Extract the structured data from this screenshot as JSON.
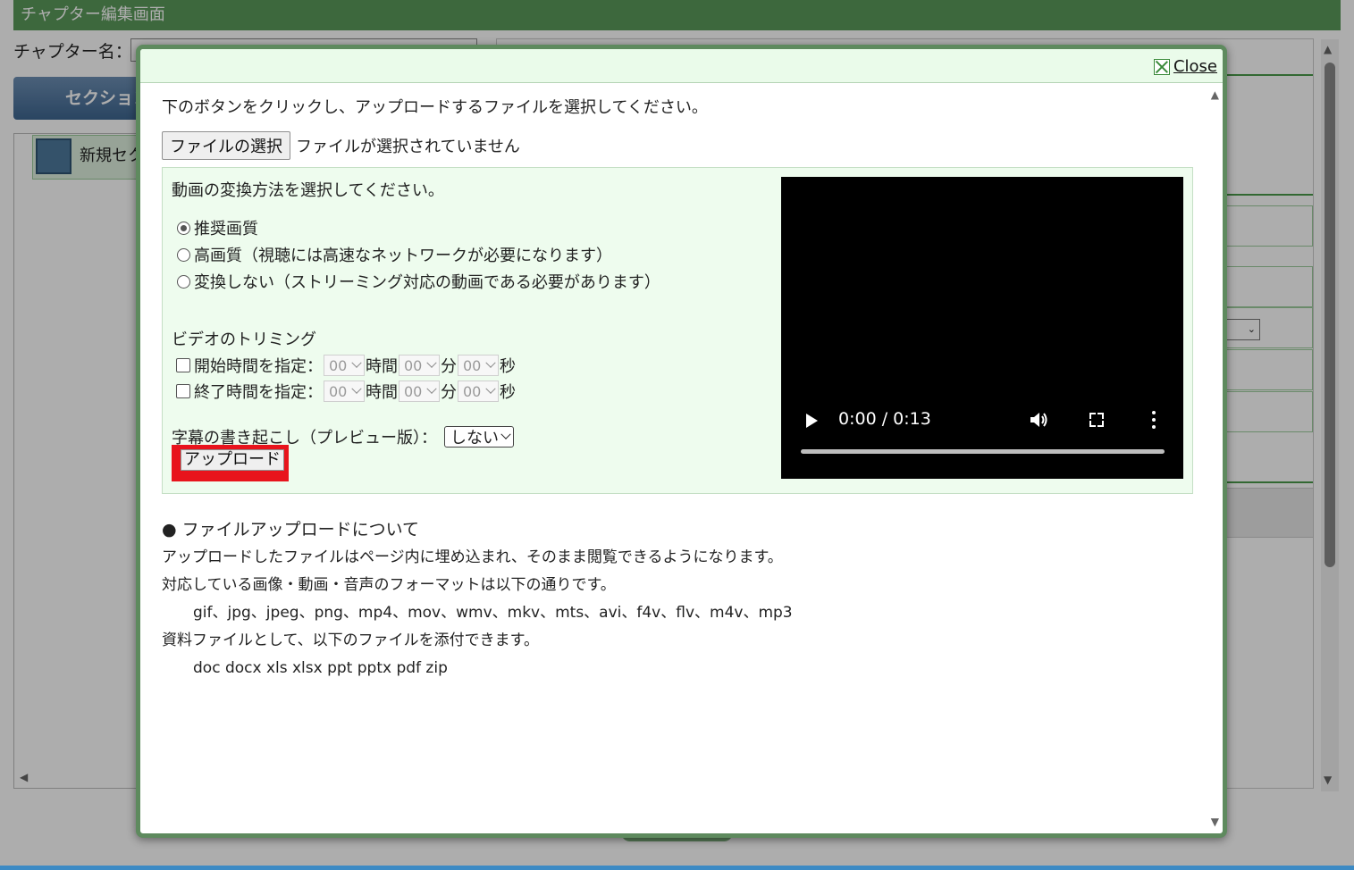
{
  "background": {
    "header_title": "チャプター編集画面",
    "chapter_label": "チャプター名：",
    "section_tab_label": "セクション",
    "new_section_label": "新規セク"
  },
  "modal": {
    "close_label": "Close",
    "instruction": "下のボタンをクリックし、アップロードするファイルを選択してください。",
    "file_button_label": "ファイルの選択",
    "file_status": "ファイルが選択されていません",
    "conversion": {
      "title": "動画の変換方法を選択してください。",
      "options": [
        {
          "label": "推奨画質",
          "checked": true
        },
        {
          "label": "高画質（視聴には高速なネットワークが必要になります）",
          "checked": false
        },
        {
          "label": "変換しない（ストリーミング対応の動画である必要があります）",
          "checked": false
        }
      ]
    },
    "trimming": {
      "title": "ビデオのトリミング",
      "start_label": "開始時間を指定：",
      "end_label": "終了時間を指定：",
      "hour_value": "00",
      "minute_value": "00",
      "second_value": "00",
      "hour_unit": "時間",
      "minute_unit": "分",
      "second_unit": "秒"
    },
    "subtitle": {
      "label": "字幕の書き起こし（プレビュー版）：",
      "selected": "しない"
    },
    "upload_button_label": "アップロード",
    "video": {
      "time": "0:00 / 0:13",
      "progress": 0
    },
    "about": {
      "heading": "● ファイルアップロードについて",
      "line1": "アップロードしたファイルはページ内に埋め込まれ、そのまま閲覧できるようになります。",
      "line2": "対応している画像・動画・音声のフォーマットは以下の通りです。",
      "media_formats": "gif、jpg、jpeg、png、mp4、mov、wmv、mkv、mts、avi、f4v、flv、m4v、mp3",
      "line3": "資料ファイルとして、以下のファイルを添付できます。",
      "doc_formats": "doc docx xls xlsx ppt pptx pdf zip"
    }
  }
}
